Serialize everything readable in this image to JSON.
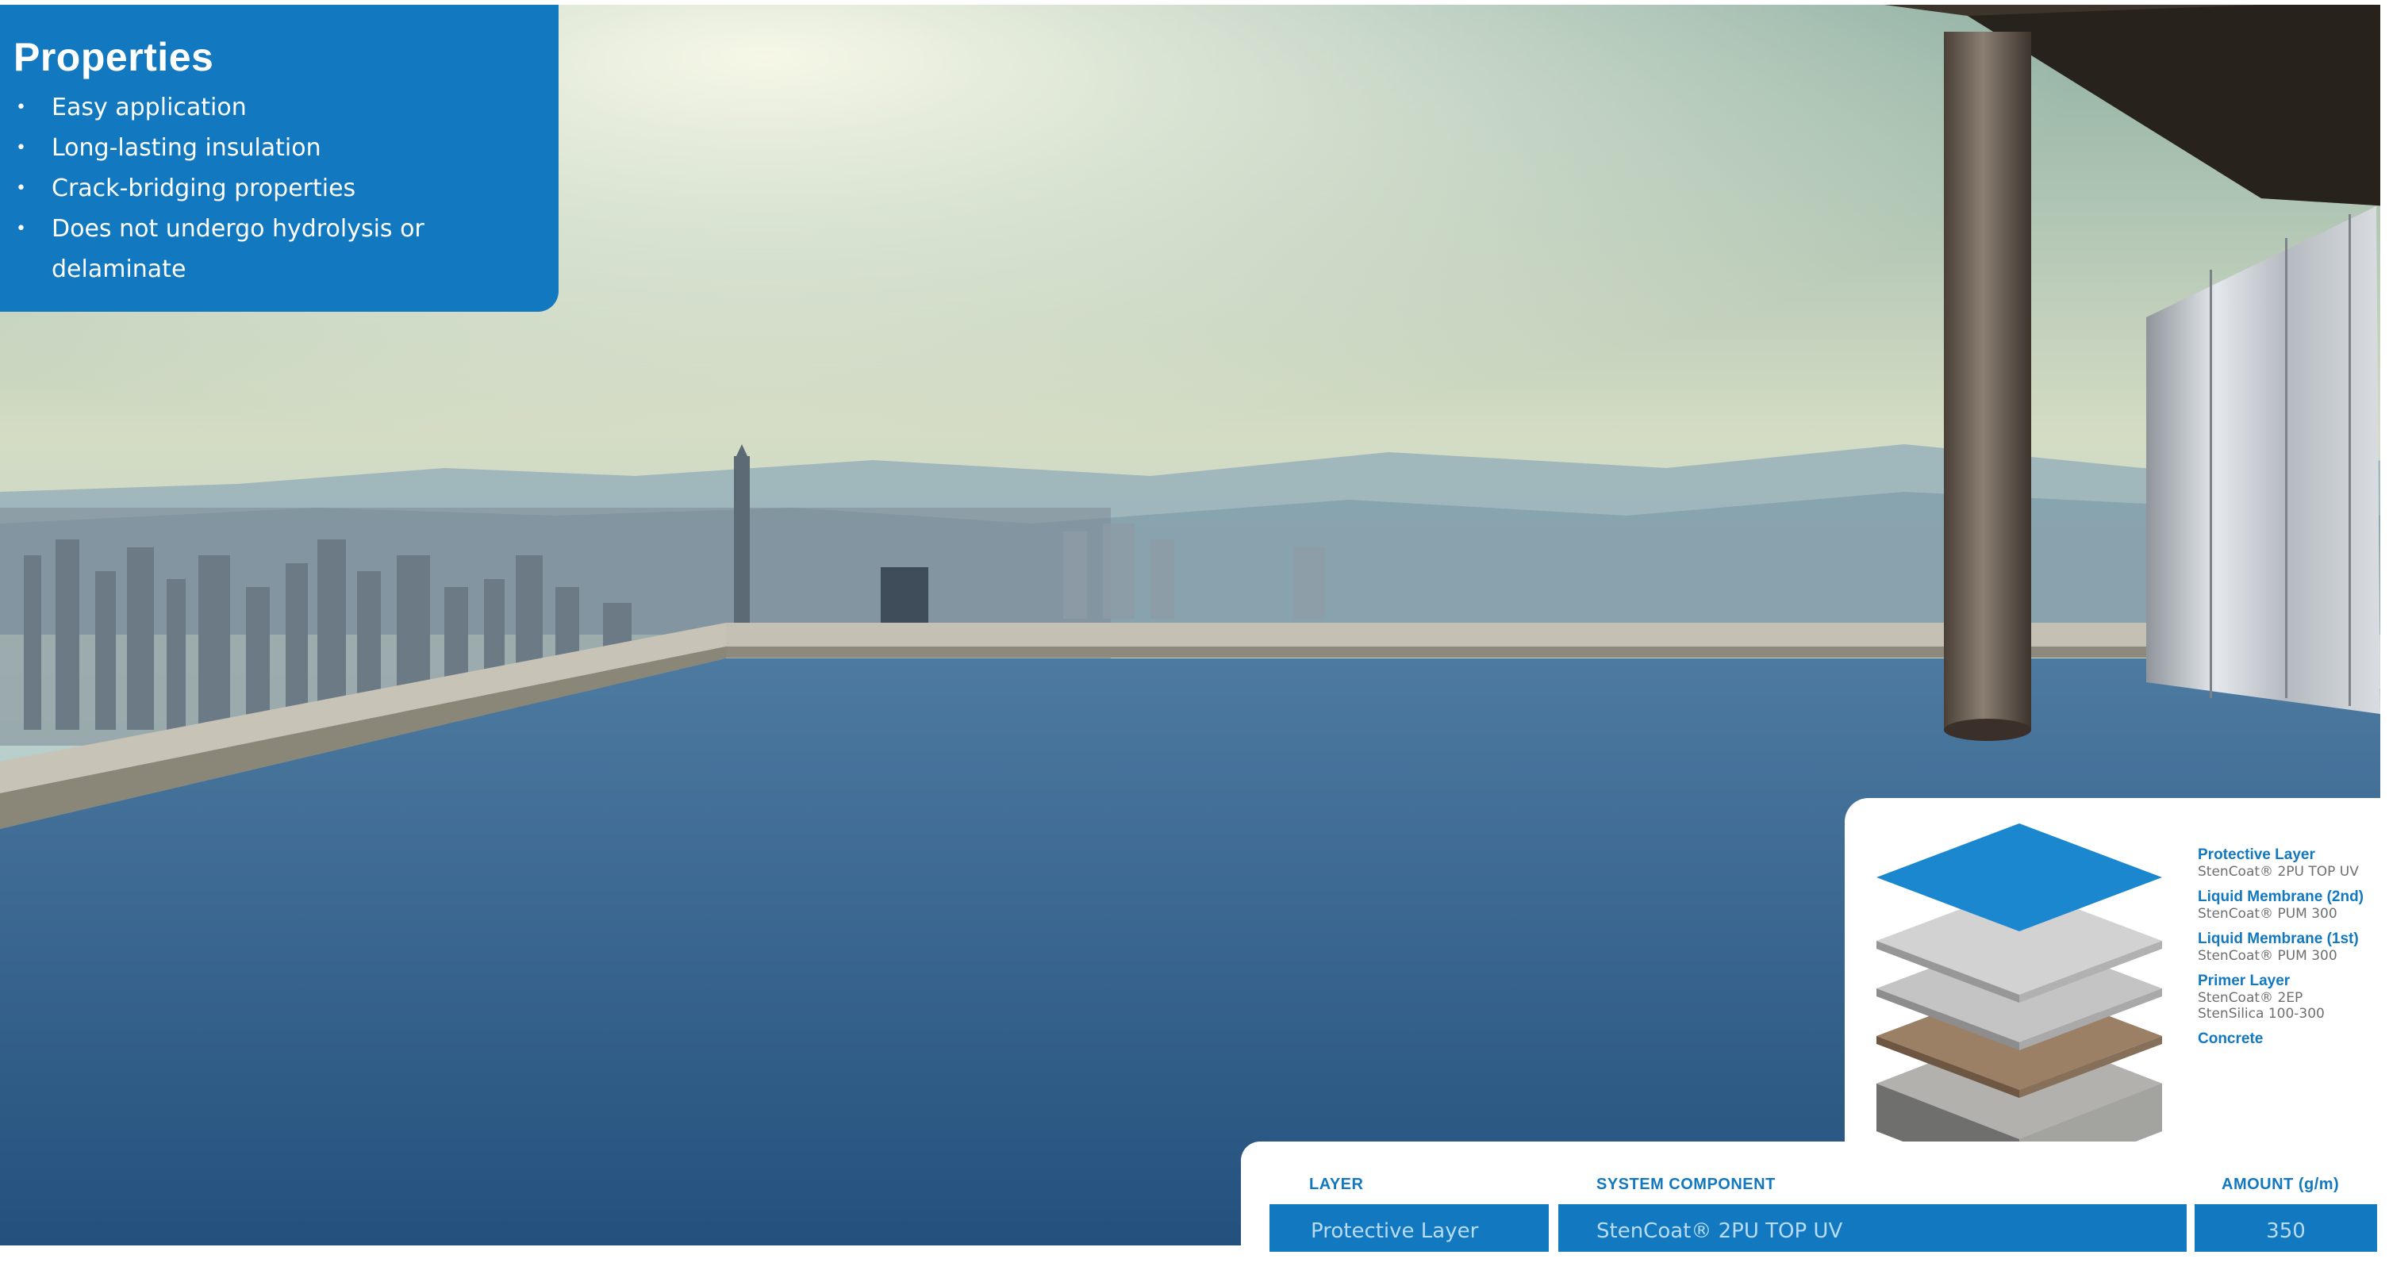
{
  "properties": {
    "title": "Properties",
    "items": [
      "Easy application",
      "Long-lasting insulation",
      "Crack-bridging properties",
      "Does not undergo hydrolysis or delaminate"
    ]
  },
  "layers": [
    {
      "title": "Protective Layer",
      "lines": [
        "StenCoat® 2PU TOP UV"
      ]
    },
    {
      "title": "Liquid Membrane (2nd)",
      "lines": [
        "StenCoat® PUM 300"
      ]
    },
    {
      "title": "Liquid Membrane (1st)",
      "lines": [
        "StenCoat® PUM 300"
      ]
    },
    {
      "title": "Primer Layer",
      "lines": [
        "StenCoat® 2EP",
        "StenSilica 100-300"
      ]
    },
    {
      "title": "Concrete",
      "lines": []
    }
  ],
  "table": {
    "headers": {
      "layer": "LAYER",
      "component": "SYSTEM COMPONENT",
      "amount": "AMOUNT (g/m)"
    },
    "rows": [
      {
        "layer": "Protective Layer",
        "component": "StenCoat® 2PU TOP UV",
        "amount": "350"
      }
    ]
  },
  "colors": {
    "brand_blue": "#1278bf",
    "floor_blue": "#2f5d88"
  }
}
